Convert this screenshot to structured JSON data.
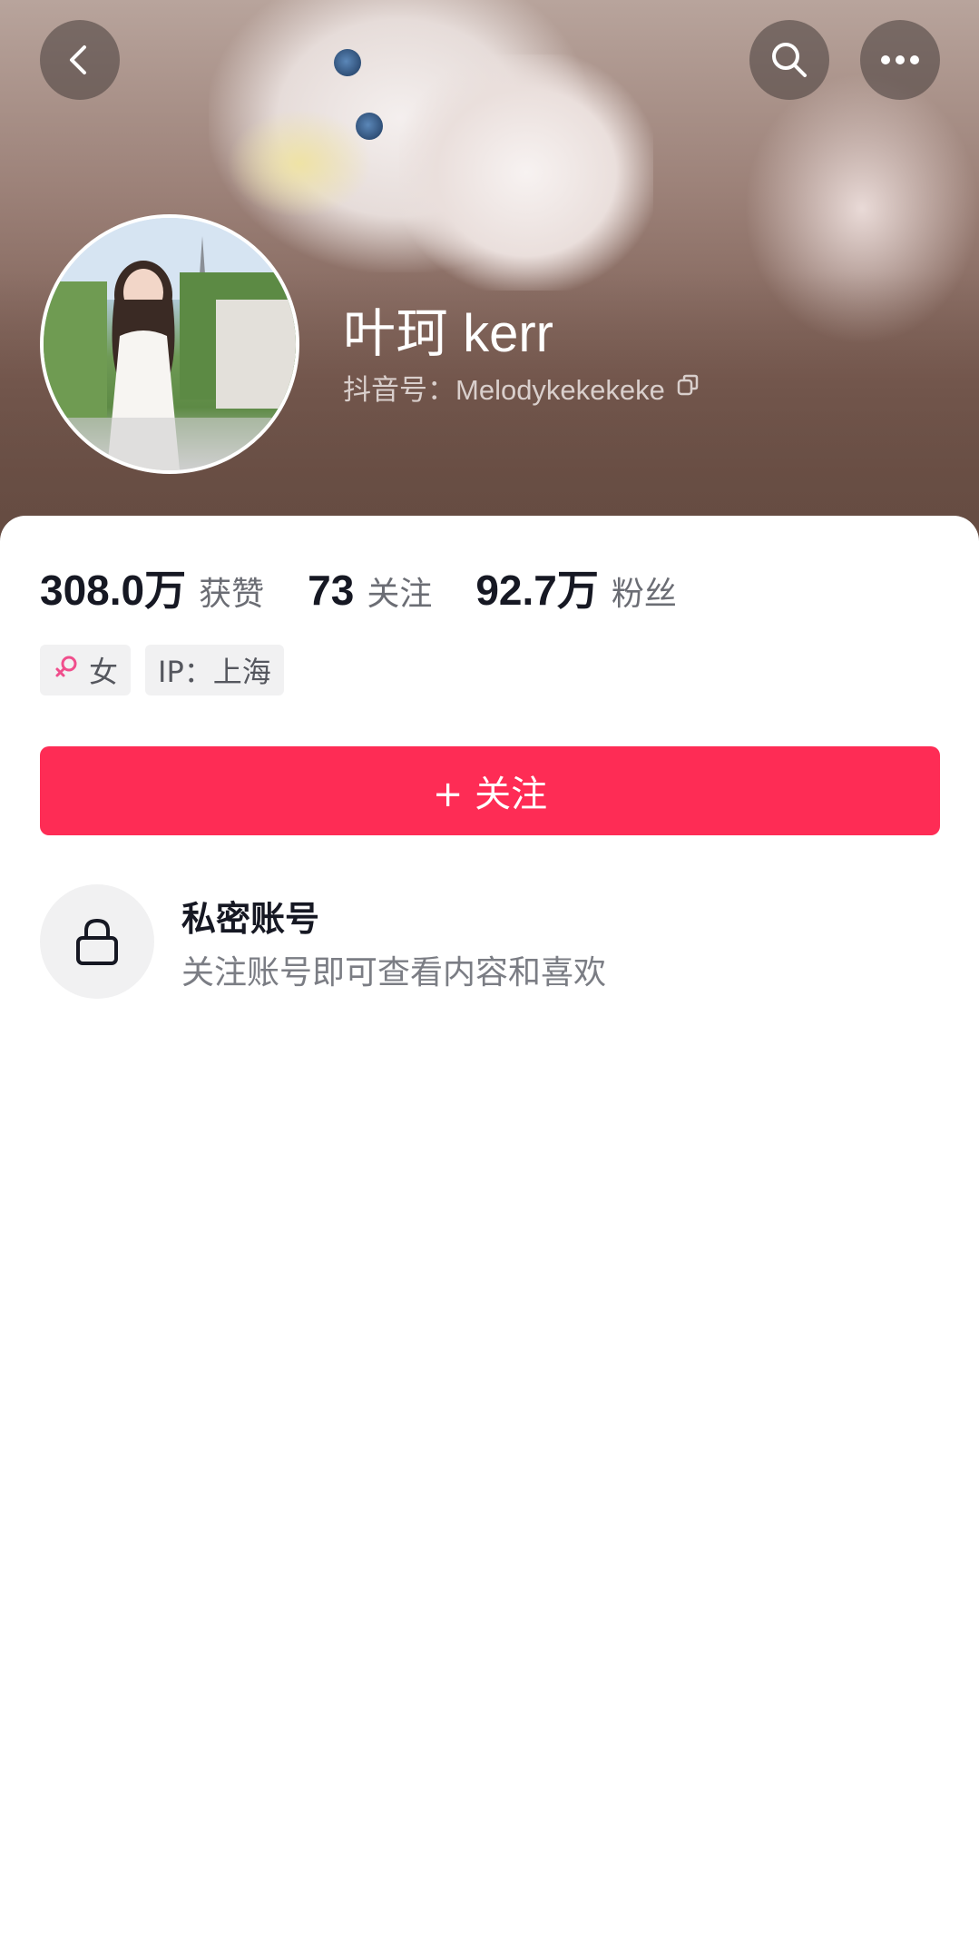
{
  "header": {
    "back_icon": "chevron-left-icon",
    "search_icon": "search-icon",
    "more_icon": "more-dots-icon"
  },
  "profile": {
    "nickname": "叶珂 kerr",
    "douyin_id": "抖音号：Melodykekekeke",
    "copy_icon": "copy-icon"
  },
  "stats": [
    {
      "value": "308.0万",
      "label": "获赞"
    },
    {
      "value": "73",
      "label": "关注"
    },
    {
      "value": "92.7万",
      "label": "粉丝"
    }
  ],
  "tags": {
    "gender": "女",
    "gender_icon": "female-symbol-icon",
    "ip": "IP：上海"
  },
  "follow_button": {
    "label": "+ 关注",
    "color": "#fe2c55"
  },
  "private_account": {
    "icon": "lock-icon",
    "title": "私密账号",
    "subtitle": "关注账号即可查看内容和喜欢"
  }
}
